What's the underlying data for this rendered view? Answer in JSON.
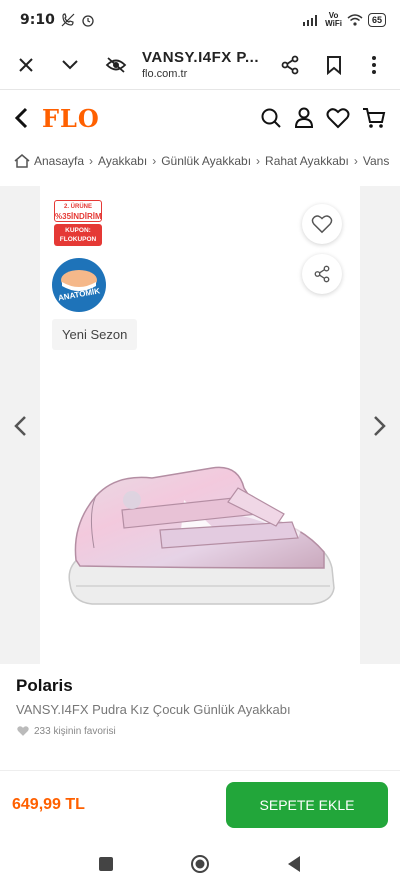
{
  "status_bar": {
    "time": "9:10",
    "network": "Vo\nWiFi",
    "battery": "65"
  },
  "browser": {
    "title": "VANSY.I4FX P...",
    "url": "flo.com.tr"
  },
  "site": {
    "logo": "FLO"
  },
  "breadcrumb": [
    "Anasayfa",
    "Ayakkabı",
    "Günlük Ayakkabı",
    "Rahat Ayakkabı",
    "Vans"
  ],
  "badges": {
    "sale_line1": "2. ÜRÜNE",
    "sale_line2": "%35İNDİRİM",
    "coupon_line1": "KUPON:",
    "coupon_line2": "FLOKUPON",
    "anatomik": "ANATOMİK",
    "new_season": "Yeni Sezon"
  },
  "product": {
    "brand": "Polaris",
    "name": "VANSY.I4FX Pudra Kız Çocuk Günlük Ayakkabı",
    "favorites": "233 kişinin favorisi",
    "price": "649,99 TL",
    "add_to_cart": "SEPETE EKLE"
  },
  "colors": {
    "brand_orange": "#ff6000",
    "cta_green": "#22a63a",
    "sale_red": "#e53935"
  }
}
